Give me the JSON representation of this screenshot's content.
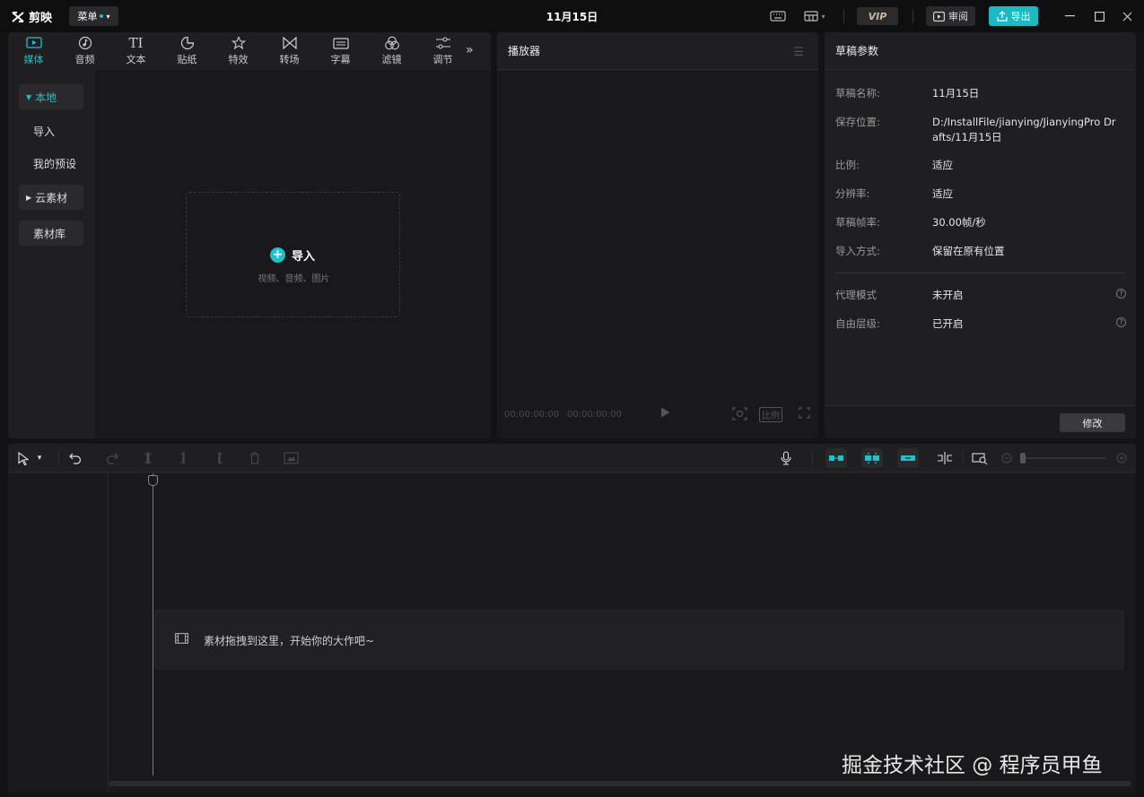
{
  "app": {
    "logo_text": "剪映",
    "menu_label": "菜单",
    "title": "11月15日",
    "vip": "VIP",
    "review": "审阅",
    "export": "导出"
  },
  "media": {
    "tabs": [
      {
        "label": "媒体",
        "icon": "media-icon"
      },
      {
        "label": "音频",
        "icon": "audio-icon"
      },
      {
        "label": "文本",
        "icon": "text-icon"
      },
      {
        "label": "贴纸",
        "icon": "sticker-icon"
      },
      {
        "label": "特效",
        "icon": "effects-icon"
      },
      {
        "label": "转场",
        "icon": "transition-icon"
      },
      {
        "label": "字幕",
        "icon": "subtitle-icon"
      },
      {
        "label": "滤镜",
        "icon": "filter-icon"
      },
      {
        "label": "调节",
        "icon": "adjust-icon"
      }
    ],
    "sidebar": {
      "local": "本地",
      "import": "导入",
      "presets": "我的预设",
      "cloud": "云素材",
      "library": "素材库"
    },
    "import_label": "导入",
    "import_sub": "视频、音频、图片"
  },
  "player": {
    "title": "播放器",
    "time_current": "00:00:00:00",
    "time_total": "00:00:00:00",
    "ratio_label": "比例"
  },
  "params": {
    "title": "草稿参数",
    "rows": [
      {
        "label": "草稿名称:",
        "value": "11月15日"
      },
      {
        "label": "保存位置:",
        "value": "D:/InstallFile/jianying/JianyingPro Drafts/11月15日"
      },
      {
        "label": "比例:",
        "value": "适应"
      },
      {
        "label": "分辨率:",
        "value": "适应"
      },
      {
        "label": "草稿帧率:",
        "value": "30.00帧/秒"
      },
      {
        "label": "导入方式:",
        "value": "保留在原有位置"
      },
      {
        "label": "代理模式",
        "value": "未开启"
      },
      {
        "label": "自由层级:",
        "value": "已开启"
      }
    ],
    "modify": "修改"
  },
  "timeline": {
    "drop_hint": "素材拖拽到这里，开始你的大作吧~"
  },
  "watermark": "掘金技术社区 @ 程序员甲鱼",
  "colors": {
    "accent": "#22c0c8",
    "bg": "#131315",
    "panel": "#1f1f21"
  }
}
